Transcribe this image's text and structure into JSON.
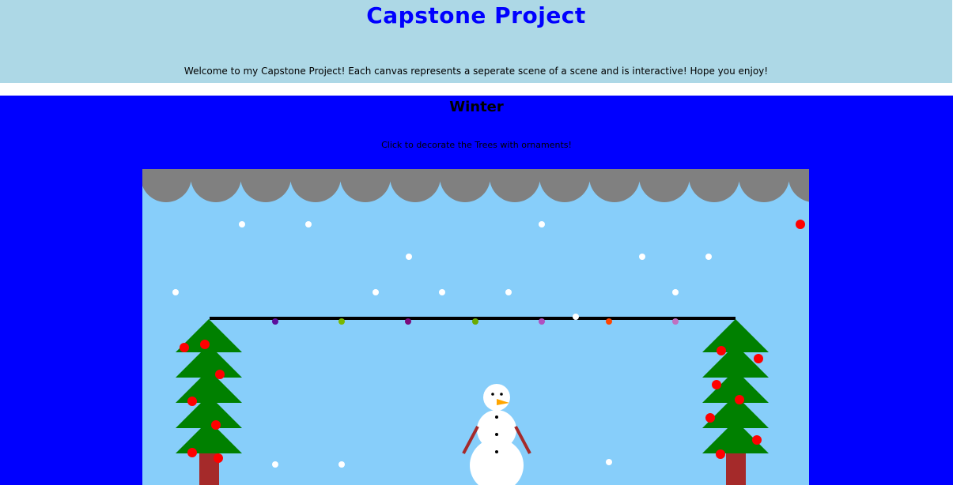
{
  "header": {
    "title": "Capstone Project",
    "welcome": "Welcome to my Capstone Project! Each canvas represents a seperate scene of a scene and is interactive! Hope you enjoy!",
    "background_color": "#add8e6",
    "title_color": "#0000ff"
  },
  "winter": {
    "title": "Winter",
    "instructions": "Click to decorate the Trees with ornaments!",
    "section_color": "#0000ff",
    "canvas": {
      "sky_color": "#87cefa",
      "cloud_color": "#808080",
      "snow_color": "#ffffff",
      "tree_color": "#008000",
      "trunk_color": "#a52a2a",
      "ornament_color": "#ff0000",
      "string_color": "#000000",
      "light_colors": [
        "#5b0f9c",
        "#7ab800",
        "#7a0a7a",
        "#6aaa00",
        "#b050c0",
        "#ffffff",
        "#ff4500",
        "#c070c0"
      ],
      "snowman_color": "#ffffff",
      "nose_color": "#ffa500",
      "arm_color": "#a52a2a"
    }
  }
}
